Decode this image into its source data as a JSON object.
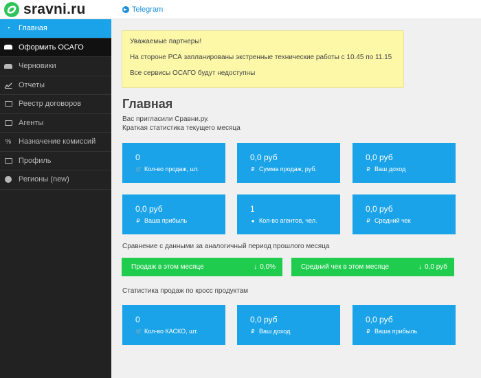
{
  "header": {
    "logo_text": "sravni.ru",
    "telegram_label": "Telegram"
  },
  "sidebar": {
    "items": [
      {
        "label": "Главная",
        "icon": "dashboard-icon"
      },
      {
        "label": "Оформить ОСАГО",
        "icon": "car-icon"
      },
      {
        "label": "Черновики",
        "icon": "car-icon"
      },
      {
        "label": "Отчеты",
        "icon": "line-chart-icon"
      },
      {
        "label": "Реестр договоров",
        "icon": "registry-icon"
      },
      {
        "label": "Агенты",
        "icon": "id-card-icon"
      },
      {
        "label": "Назначение комиссий",
        "icon": "percent-icon"
      },
      {
        "label": "Профиль",
        "icon": "id-card-icon"
      },
      {
        "label": "Регионы (new)",
        "icon": "globe-icon"
      }
    ]
  },
  "notice": {
    "line1": "Уважаемые партнеры!",
    "line2": "На стороне РСА запланированы экстренные технические работы с 10.45 по 11.15",
    "line3": "Все сервисы ОСАГО будут недоступны"
  },
  "main": {
    "title": "Главная",
    "invited": "Вас пригласили Сравни.ру.",
    "stats_caption": "Краткая статистика текущего месяца",
    "cards_row1": [
      {
        "value": "0",
        "icon": "cart-icon",
        "label": "Кол-во продаж, шт."
      },
      {
        "value": "0,0 руб",
        "icon": "ruble-icon",
        "label": "Сумма продаж, руб."
      },
      {
        "value": "0,0 руб",
        "icon": "ruble-icon",
        "label": "Ваш доход"
      }
    ],
    "cards_row2": [
      {
        "value": "0,0 руб",
        "icon": "ruble-icon",
        "label": "Ваша прибыль"
      },
      {
        "value": "1",
        "icon": "user-icon",
        "label": "Кол-во агентов, чел."
      },
      {
        "value": "0,0 руб",
        "icon": "ruble-icon",
        "label": "Средний чек"
      }
    ],
    "comparison_caption": "Сравнение с данными за аналогичный период прошлого месяца",
    "comparison": [
      {
        "label": "Продаж в этом месяце",
        "value": "0,0%"
      },
      {
        "label": "Средний чек в этом месяце",
        "value": "0,0 руб"
      }
    ],
    "cross_caption": "Статистика продаж по кросс продуктам",
    "cards_row3": [
      {
        "value": "0",
        "icon": "cart-icon",
        "label": "Кол-во КАСКО, шт."
      },
      {
        "value": "0,0 руб",
        "icon": "ruble-icon",
        "label": "Ваш доход"
      },
      {
        "value": "0,0 руб",
        "icon": "ruble-icon",
        "label": "Ваша прибыль"
      }
    ]
  },
  "colors": {
    "sidebar_bg": "#222222",
    "accent_blue": "#1aa3e8",
    "success_green": "#1fcc4e",
    "notice_yellow": "#fcf8a8",
    "logo_green": "#2ec45a"
  }
}
